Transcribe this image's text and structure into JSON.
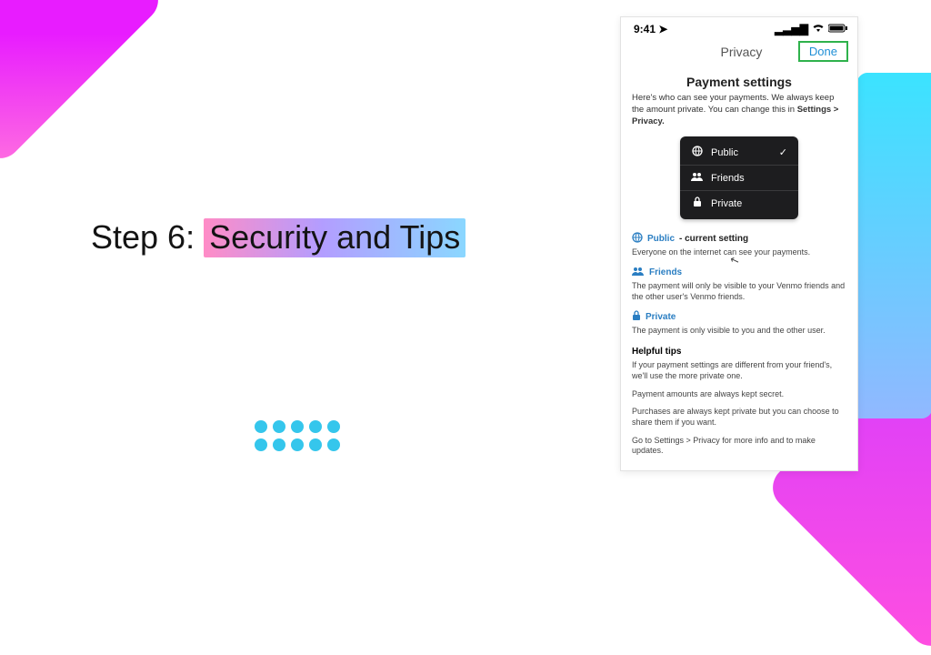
{
  "decor": {
    "dot_count": 10
  },
  "heading": {
    "prefix": "Step 6: ",
    "highlight": "Security and Tips"
  },
  "phone": {
    "status": {
      "time": "9:41",
      "loc_arrow": "➤",
      "signal": "▂▃▅▇",
      "wifi": "▾",
      "battery": "■"
    },
    "nav": {
      "title": "Privacy",
      "done": "Done"
    },
    "page_title": "Payment settings",
    "intro_a": "Here's who can see your payments. We always keep the amount private. You can change this in",
    "intro_b": "Settings > Privacy.",
    "selector": [
      {
        "icon": "globe",
        "label": "Public",
        "checked": true
      },
      {
        "icon": "friends",
        "label": "Friends",
        "checked": false
      },
      {
        "icon": "lock",
        "label": "Private",
        "checked": false
      }
    ],
    "options": [
      {
        "icon": "globe",
        "name": "Public",
        "suffix": " - current setting",
        "desc": "Everyone on the internet can see your payments."
      },
      {
        "icon": "friends",
        "name": "Friends",
        "suffix": "",
        "desc": "The payment will only be visible to your Venmo friends and the other user's Venmo friends."
      },
      {
        "icon": "lock",
        "name": "Private",
        "suffix": "",
        "desc": "The payment is only visible to you and the other user."
      }
    ],
    "tips_title": "Helpful tips",
    "tips": [
      "If your payment settings are different from your friend's, we'll use the more private one.",
      "Payment amounts are always kept secret.",
      "Purchases are always kept private but you can choose to share them if you want.",
      "Go to Settings > Privacy for more info and to make updates."
    ]
  }
}
